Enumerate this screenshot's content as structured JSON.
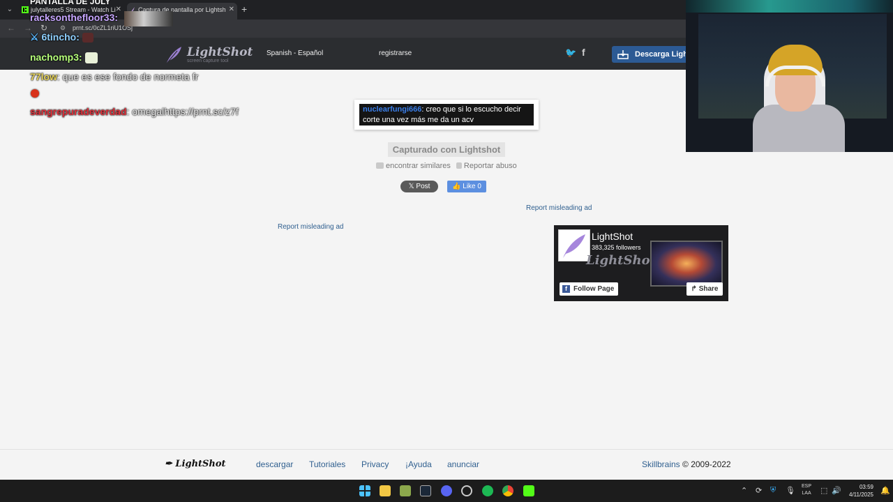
{
  "browser": {
    "tabs": [
      {
        "title": "julytalleres5 Stream - Watch Li"
      },
      {
        "title": "Captura de pantalla por Lightsh"
      }
    ],
    "url": "prnt.sc/0cZL1riU1OSj"
  },
  "header": {
    "logo": "LightShot",
    "logo_sub": "screen capture tool",
    "language": "Spanish - Español",
    "register": "registrarse",
    "download": "Descarga Light"
  },
  "chat": {
    "top": "PANTALLA DE JULY",
    "lines": [
      {
        "user": "racksonthefloor33:",
        "text": "",
        "color": "#c7a6ff"
      },
      {
        "user": "6tincho:",
        "text": "",
        "color": "#8fd0ff"
      },
      {
        "user": "nachomp3:",
        "text": "",
        "color": "#b6ff7a"
      },
      {
        "user": "77low",
        "text": ": que es ese fondo de normeta fr",
        "color": "#e6d35a"
      },
      {
        "user": "sangrepuradeverdad",
        "text": ": omegalhttps://prnt.sc/z7f",
        "color": "#e0303a"
      }
    ]
  },
  "screenshot": {
    "nick": "nuclearfungi666",
    "message": ": creo que si lo escucho decir corte una vez más me da un acv"
  },
  "captured": "Capturado con Lightshot",
  "actions": {
    "similar": "encontrar similares",
    "report": "Reportar abuso"
  },
  "social": {
    "post": "Post",
    "like": "Like 0"
  },
  "misleading": {
    "right": "Report misleading ad",
    "left": "Report misleading ad"
  },
  "fb_widget": {
    "name": "LightShot",
    "followers": "383,325 followers",
    "logo": "LightShot",
    "follow": "Follow Page",
    "share": "Share"
  },
  "footer": {
    "logo": "LightShot",
    "links": [
      "descargar",
      "Tutoriales",
      "Privacy",
      "¡Ayuda",
      "anunciar"
    ],
    "company": "Skillbrains",
    "copyright": " © 2009-2022"
  },
  "taskbar": {
    "lang_line1": "ESP",
    "lang_line2": "LAA",
    "time": "03:59",
    "date": "4/11/2025"
  },
  "colors": {
    "accent": "#2c5a94",
    "link": "#2f5f8f",
    "header_bg": "#2b2d30"
  }
}
